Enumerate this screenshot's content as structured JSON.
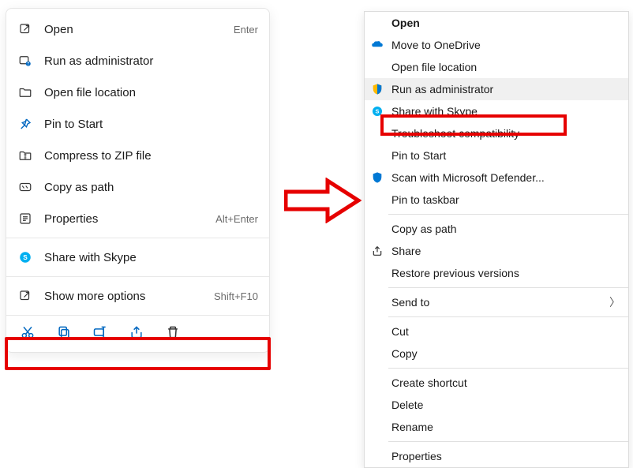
{
  "left_menu": {
    "items": [
      {
        "label": "Open",
        "shortcut": "Enter",
        "icon": "arrow-out-icon"
      },
      {
        "label": "Run as administrator",
        "shortcut": "",
        "icon": "admin-icon"
      },
      {
        "label": "Open file location",
        "shortcut": "",
        "icon": "folder-icon"
      },
      {
        "label": "Pin to Start",
        "shortcut": "",
        "icon": "pin-icon"
      },
      {
        "label": "Compress to ZIP file",
        "shortcut": "",
        "icon": "zip-icon"
      },
      {
        "label": "Copy as path",
        "shortcut": "",
        "icon": "path-icon"
      },
      {
        "label": "Properties",
        "shortcut": "Alt+Enter",
        "icon": "properties-icon"
      }
    ],
    "section2": [
      {
        "label": "Share with Skype",
        "icon": "skype-icon"
      }
    ],
    "section3": [
      {
        "label": "Show more options",
        "shortcut": "Shift+F10",
        "icon": "more-icon"
      }
    ]
  },
  "right_menu": {
    "g1": [
      {
        "label": "Open",
        "icon": "",
        "bold": true
      },
      {
        "label": "Move to OneDrive",
        "icon": "onedrive-icon"
      },
      {
        "label": "Open file location",
        "icon": ""
      },
      {
        "label": "Run as administrator",
        "icon": "shield-icon",
        "hover": true
      },
      {
        "label": "Share with Skype",
        "icon": "skype-icon"
      },
      {
        "label": "Troubleshoot compatibility",
        "icon": "",
        "highlight": true
      },
      {
        "label": "Pin to Start",
        "icon": ""
      },
      {
        "label": "Scan with Microsoft Defender...",
        "icon": "defender-icon"
      },
      {
        "label": "Pin to taskbar",
        "icon": ""
      }
    ],
    "g2": [
      {
        "label": "Copy as path",
        "icon": ""
      },
      {
        "label": "Share",
        "icon": "share-icon"
      },
      {
        "label": "Restore previous versions",
        "icon": ""
      }
    ],
    "g3": [
      {
        "label": "Send to",
        "icon": "",
        "submenu": true
      }
    ],
    "g4": [
      {
        "label": "Cut",
        "icon": ""
      },
      {
        "label": "Copy",
        "icon": ""
      }
    ],
    "g5": [
      {
        "label": "Create shortcut",
        "icon": ""
      },
      {
        "label": "Delete",
        "icon": ""
      },
      {
        "label": "Rename",
        "icon": ""
      }
    ],
    "g6": [
      {
        "label": "Properties",
        "icon": ""
      }
    ]
  },
  "colors": {
    "highlight": "#e60000",
    "skype": "#00aff0",
    "shield_yellow": "#ffb900",
    "shield_blue": "#0078d4",
    "onedrive": "#0078d4"
  }
}
